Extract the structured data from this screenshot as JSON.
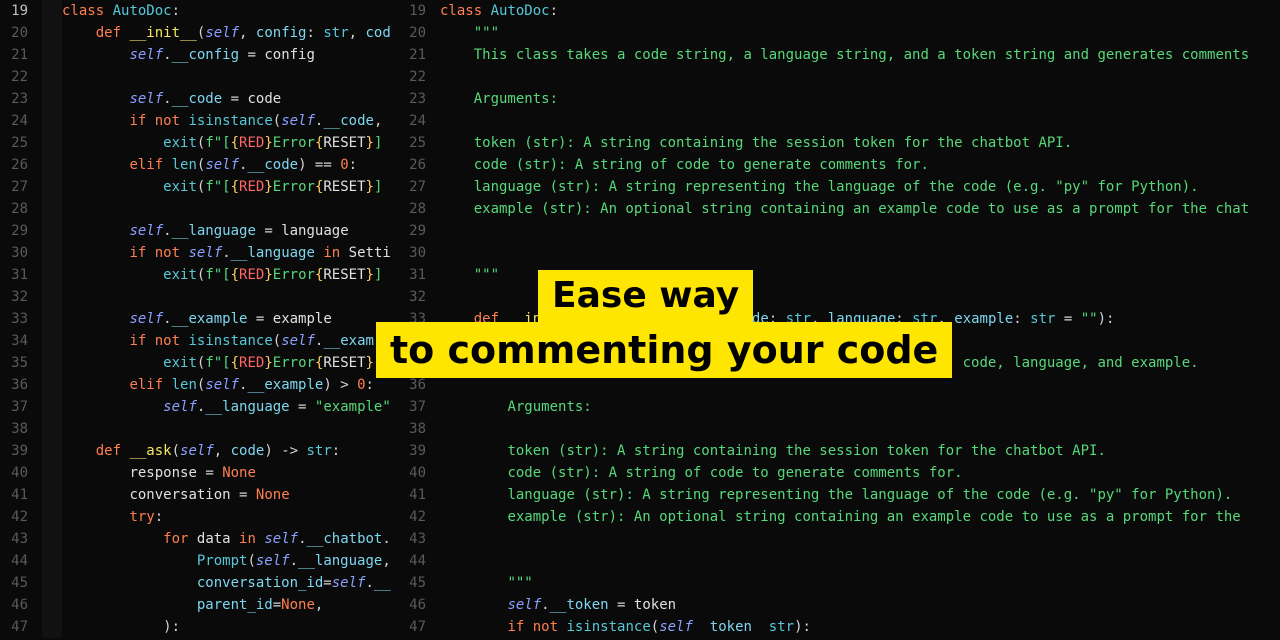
{
  "banner": {
    "line1": "Ease way",
    "line2": "to commenting your code"
  },
  "left": [
    {
      "n": "19",
      "active": true,
      "html": "<span class='kw'>class</span> <span class='type'>AutoDoc</span>:"
    },
    {
      "n": "20",
      "html": "    <span class='kw'>def</span> <span class='dunder'>__init__</span>(<span class='self'>self</span>, <span class='param'>config</span>: <span class='type'>str</span>, <span class='param'>cod</span>"
    },
    {
      "n": "21",
      "html": "        <span class='self'>self</span>.<span class='param'>__config</span> <span class='op'>=</span> <span class='local'>config</span>"
    },
    {
      "n": "22",
      "html": ""
    },
    {
      "n": "23",
      "html": "        <span class='self'>self</span>.<span class='param'>__code</span> <span class='op'>=</span> <span class='local'>code</span>"
    },
    {
      "n": "24",
      "html": "        <span class='kw'>if</span> <span class='kw'>not</span> <span class='fn'>isinstance</span>(<span class='self'>self</span>.<span class='param'>__code</span>,"
    },
    {
      "n": "25",
      "html": "            <span class='fn'>exit</span>(<span class='fstr'>f\"[</span><span class='brace'>{</span><span class='red'>RED</span><span class='brace'>}</span><span class='fstr'>Error</span><span class='brace'>{</span><span class='local'>RESET</span><span class='brace'>}</span><span class='fstr'>]</span>"
    },
    {
      "n": "26",
      "html": "        <span class='kw'>elif</span> <span class='fn'>len</span>(<span class='self'>self</span>.<span class='param'>__code</span>) <span class='op'>==</span> <span class='num'>0</span>:"
    },
    {
      "n": "27",
      "html": "            <span class='fn'>exit</span>(<span class='fstr'>f\"[</span><span class='brace'>{</span><span class='red'>RED</span><span class='brace'>}</span><span class='fstr'>Error</span><span class='brace'>{</span><span class='local'>RESET</span><span class='brace'>}</span><span class='fstr'>]</span>"
    },
    {
      "n": "28",
      "html": ""
    },
    {
      "n": "29",
      "html": "        <span class='self'>self</span>.<span class='param'>__language</span> <span class='op'>=</span> <span class='local'>language</span>"
    },
    {
      "n": "30",
      "html": "        <span class='kw'>if</span> <span class='kw'>not</span> <span class='self'>self</span>.<span class='param'>__language</span> <span class='kw'>in</span> <span class='local'>Setti</span>"
    },
    {
      "n": "31",
      "html": "            <span class='fn'>exit</span>(<span class='fstr'>f\"[</span><span class='brace'>{</span><span class='red'>RED</span><span class='brace'>}</span><span class='fstr'>Error</span><span class='brace'>{</span><span class='local'>RESET</span><span class='brace'>}</span><span class='fstr'>]</span>"
    },
    {
      "n": "32",
      "html": ""
    },
    {
      "n": "33",
      "html": "        <span class='self'>self</span>.<span class='param'>__example</span> <span class='op'>=</span> <span class='local'>example</span>"
    },
    {
      "n": "34",
      "html": "        <span class='kw'>if</span> <span class='kw'>not</span> <span class='fn'>isinstance</span>(<span class='self'>self</span>.<span class='param'>__exam</span>"
    },
    {
      "n": "35",
      "html": "            <span class='fn'>exit</span>(<span class='fstr'>f\"[</span><span class='brace'>{</span><span class='red'>RED</span><span class='brace'>}</span><span class='fstr'>Error</span><span class='brace'>{</span><span class='local'>RESET</span><span class='brace'>}</span><span class='fstr'>]</span>"
    },
    {
      "n": "36",
      "html": "        <span class='kw'>elif</span> <span class='fn'>len</span>(<span class='self'>self</span>.<span class='param'>__example</span>) <span class='op'>&gt;</span> <span class='num'>0</span>:"
    },
    {
      "n": "37",
      "html": "            <span class='self'>self</span>.<span class='param'>__language</span> <span class='op'>=</span> <span class='str'>\"example\"</span>"
    },
    {
      "n": "38",
      "html": ""
    },
    {
      "n": "39",
      "html": "    <span class='kw'>def</span> <span class='method'>__ask</span>(<span class='self'>self</span>, <span class='param'>code</span>) <span class='op'>-&gt;</span> <span class='type'>str</span>:"
    },
    {
      "n": "40",
      "html": "        <span class='local'>response</span> <span class='op'>=</span> <span class='const'>None</span>"
    },
    {
      "n": "41",
      "html": "        <span class='local'>conversation</span> <span class='op'>=</span> <span class='const'>None</span>"
    },
    {
      "n": "42",
      "html": "        <span class='kw'>try</span>:"
    },
    {
      "n": "43",
      "html": "            <span class='kw'>for</span> <span class='local'>data</span> <span class='kw'>in</span> <span class='self'>self</span>.<span class='param'>__chatbot</span>."
    },
    {
      "n": "44",
      "html": "                <span class='fn'>Prompt</span>(<span class='self'>self</span>.<span class='param'>__language</span>,"
    },
    {
      "n": "45",
      "html": "                <span class='param'>conversation_id</span><span class='op'>=</span><span class='self'>self</span>.<span class='param'>__</span>"
    },
    {
      "n": "46",
      "html": "                <span class='param'>parent_id</span><span class='op'>=</span><span class='const'>None</span>,"
    },
    {
      "n": "47",
      "html": "            ):"
    }
  ],
  "right": [
    {
      "n": "19",
      "html": "<span class='kw'>class</span> <span class='type'>AutoDoc</span>:"
    },
    {
      "n": "20",
      "html": "    <span class='docstr'>\"\"\"</span>"
    },
    {
      "n": "21",
      "html": "    <span class='docstr'>This class takes a code string, a language string, and a token string and generates comments</span>"
    },
    {
      "n": "22",
      "html": ""
    },
    {
      "n": "23",
      "html": "    <span class='docstr'>Arguments:</span>"
    },
    {
      "n": "24",
      "html": ""
    },
    {
      "n": "25",
      "html": "    <span class='docstr'>token (str): A string containing the session token for the chatbot API.</span>"
    },
    {
      "n": "26",
      "html": "    <span class='docstr'>code (str): A string of code to generate comments for.</span>"
    },
    {
      "n": "27",
      "html": "    <span class='docstr'>language (str): A string representing the language of the code (e.g. \"py\" for Python).</span>"
    },
    {
      "n": "28",
      "html": "    <span class='docstr'>example (str): An optional string containing an example code to use as a prompt for the chat</span>"
    },
    {
      "n": "29",
      "html": ""
    },
    {
      "n": "30",
      "html": ""
    },
    {
      "n": "31",
      "html": "    <span class='docstr'>\"\"\"</span>"
    },
    {
      "n": "32",
      "html": ""
    },
    {
      "n": "33",
      "html": "    <span class='kw'>def</span> <span class='dunder'>__init__</span>(<span class='self'>self</span>, <span class='param'>token</span>: <span class='type'>str</span>, <span class='param'>code</span>: <span class='type'>str</span>, <span class='param'>language</span>: <span class='type'>str</span>, <span class='param'>example</span>: <span class='type'>str</span> <span class='op'>=</span> <span class='str'>\"\"</span>):"
    },
    {
      "n": "34",
      "html": "        <span class='docstr'>\"\"\"</span>"
    },
    {
      "n": "35",
      "html": "        <span class='docstr'>Initializes an AutoDoc instance with the given token, code, language, and example.</span>"
    },
    {
      "n": "36",
      "html": ""
    },
    {
      "n": "37",
      "html": "        <span class='docstr'>Arguments:</span>"
    },
    {
      "n": "38",
      "html": ""
    },
    {
      "n": "39",
      "html": "        <span class='docstr'>token (str): A string containing the session token for the chatbot API.</span>"
    },
    {
      "n": "40",
      "html": "        <span class='docstr'>code (str): A string of code to generate comments for.</span>"
    },
    {
      "n": "41",
      "html": "        <span class='docstr'>language (str): A string representing the language of the code (e.g. \"py\" for Python).</span>"
    },
    {
      "n": "42",
      "html": "        <span class='docstr'>example (str): An optional string containing an example code to use as a prompt for the </span>"
    },
    {
      "n": "43",
      "html": ""
    },
    {
      "n": "44",
      "html": ""
    },
    {
      "n": "45",
      "html": "        <span class='docstr'>\"\"\"</span>"
    },
    {
      "n": "46",
      "html": "        <span class='self'>self</span>.<span class='param'>__token</span> <span class='op'>=</span> <span class='local'>token</span>"
    },
    {
      "n": "47",
      "html": "        <span class='kw'>if</span> <span class='kw'>not</span> <span class='fn'>isinstance</span>(<span class='self'>self</span>  <span class='param'>token</span>  <span class='type'>str</span>):"
    }
  ]
}
